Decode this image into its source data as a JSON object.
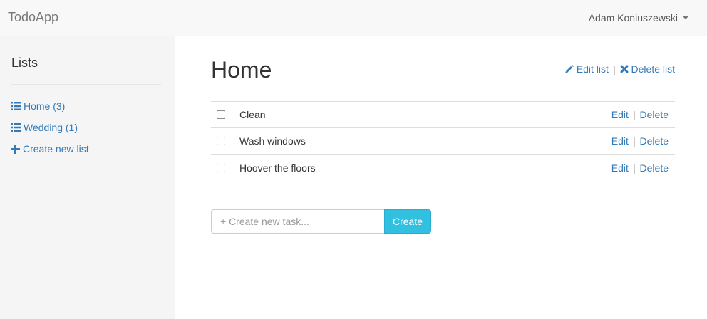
{
  "navbar": {
    "brand": "TodoApp",
    "user_name": "Adam Koniuszewski"
  },
  "sidebar": {
    "title": "Lists",
    "items": [
      {
        "label": "Home (3)",
        "icon": "list-icon"
      },
      {
        "label": "Wedding (1)",
        "icon": "list-icon"
      }
    ],
    "create_label": "Create new list",
    "create_icon": "plus-icon"
  },
  "main": {
    "title": "Home",
    "edit_list_label": "Edit list",
    "delete_list_label": "Delete list",
    "separator": "|",
    "tasks": [
      {
        "label": "Clean",
        "checked": false,
        "edit_label": "Edit",
        "delete_label": "Delete"
      },
      {
        "label": "Wash windows",
        "checked": false,
        "edit_label": "Edit",
        "delete_label": "Delete"
      },
      {
        "label": "Hoover the floors",
        "checked": false,
        "edit_label": "Edit",
        "delete_label": "Delete"
      }
    ],
    "new_task": {
      "placeholder": "+ Create new task...",
      "value": "",
      "button_label": "Create"
    }
  },
  "colors": {
    "link": "#337ab7",
    "button": "#31c0e0",
    "sidebar_bg": "#f5f5f5",
    "navbar_bg": "#f8f8f8"
  }
}
